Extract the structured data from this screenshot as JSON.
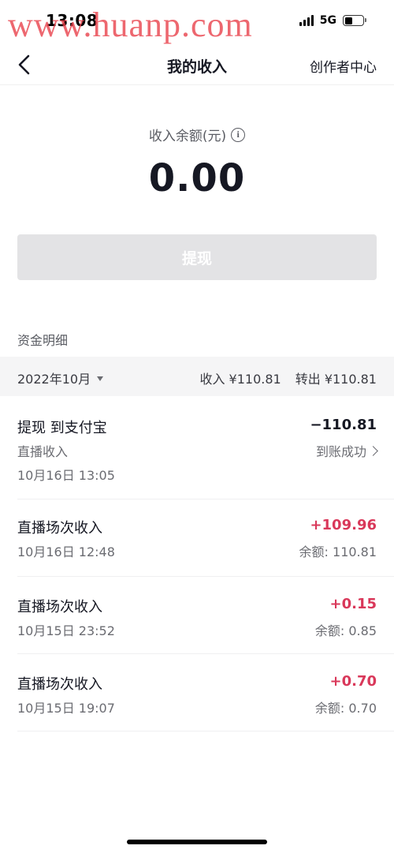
{
  "status": {
    "time": "13:08",
    "network": "5G"
  },
  "watermark": "www.huanp.com",
  "nav": {
    "title": "我的收入",
    "right_label": "创作者中心"
  },
  "balance": {
    "label": "收入余额(元)",
    "amount": "0.00"
  },
  "withdraw_label": "提现",
  "section_title": "资金明细",
  "filter": {
    "month": "2022年10月",
    "income": "收入 ¥110.81",
    "transfer_out": "转出 ¥110.81"
  },
  "transactions": [
    {
      "title": "提现 到支付宝",
      "subtitle": "直播收入",
      "date": "10月16日 13:05",
      "amount": "−110.81",
      "status": "到账成功"
    },
    {
      "title": "直播场次收入",
      "date": "10月16日 12:48",
      "amount": "+109.96",
      "balance": "余额: 110.81"
    },
    {
      "title": "直播场次收入",
      "date": "10月15日 23:52",
      "amount": "+0.15",
      "balance": "余额: 0.85"
    },
    {
      "title": "直播场次收入",
      "date": "10月15日 19:07",
      "amount": "+0.70",
      "balance": "余额: 0.70"
    }
  ],
  "colors": {
    "positive": "#d9385a",
    "disabled_button": "#e3e3e5",
    "filter_bg": "#f5f5f6",
    "watermark": "#e83c46"
  },
  "icons": [
    "back-arrow-icon",
    "info-icon",
    "caret-down-icon",
    "chevron-right-icon",
    "battery-icon",
    "signal-icon"
  ]
}
